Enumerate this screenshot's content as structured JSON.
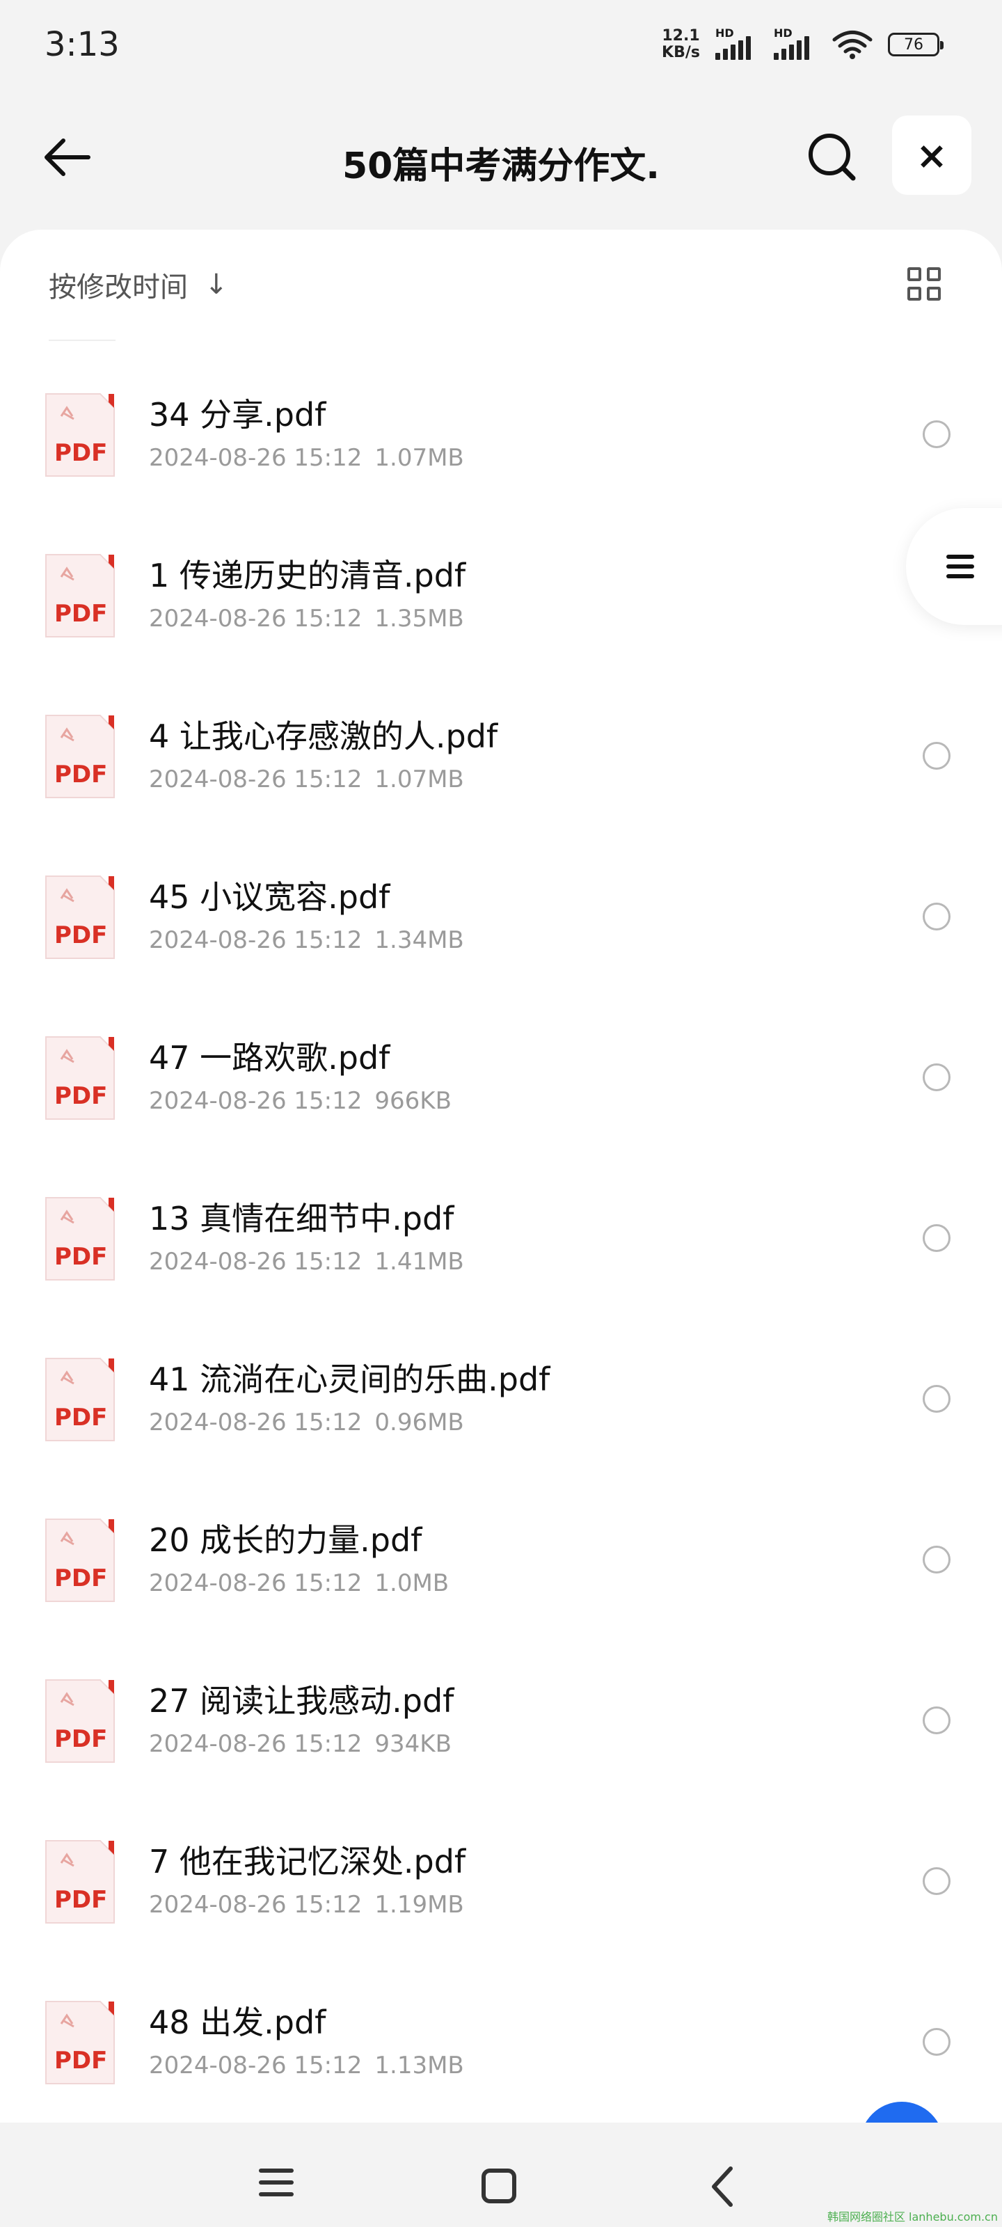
{
  "status_bar": {
    "time": "3:13",
    "net_speed_value": "12.1",
    "net_speed_unit": "KB/s",
    "sim1_label": "HD",
    "sim2_label": "HD",
    "battery": "76"
  },
  "header": {
    "title": "50篇中考满分作文.",
    "close_label": "×"
  },
  "sort": {
    "label": "按修改时间",
    "arrow": "↓"
  },
  "icon_label": "PDF",
  "files": [
    {
      "name": "34 分享.pdf",
      "date": "2024-08-26 15:12",
      "size": "1.07MB"
    },
    {
      "name": "1 传递历史的清音.pdf",
      "date": "2024-08-26 15:12",
      "size": "1.35MB"
    },
    {
      "name": "4 让我心存感激的人.pdf",
      "date": "2024-08-26 15:12",
      "size": "1.07MB"
    },
    {
      "name": "45 小议宽容.pdf",
      "date": "2024-08-26 15:12",
      "size": "1.34MB"
    },
    {
      "name": "47 一路欢歌.pdf",
      "date": "2024-08-26 15:12",
      "size": "966KB"
    },
    {
      "name": "13 真情在细节中.pdf",
      "date": "2024-08-26 15:12",
      "size": "1.41MB"
    },
    {
      "name": "41 流淌在心灵间的乐曲.pdf",
      "date": "2024-08-26 15:12",
      "size": "0.96MB"
    },
    {
      "name": "20 成长的力量.pdf",
      "date": "2024-08-26 15:12",
      "size": "1.0MB"
    },
    {
      "name": "27 阅读让我感动.pdf",
      "date": "2024-08-26 15:12",
      "size": "934KB"
    },
    {
      "name": "7 他在我记忆深处.pdf",
      "date": "2024-08-26 15:12",
      "size": "1.19MB"
    },
    {
      "name": "48 出发.pdf",
      "date": "2024-08-26 15:12",
      "size": "1.13MB"
    }
  ],
  "watermark": "韩国网络圈社区 lanhebu.com.cn",
  "colors": {
    "pdf_red": "#d93025",
    "pdf_bg": "#fbeeee",
    "fab_blue": "#1f6bf0"
  }
}
